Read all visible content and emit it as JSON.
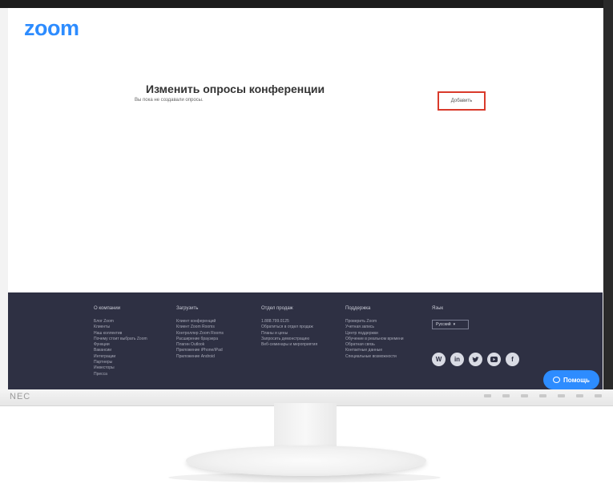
{
  "brand": {
    "logo_text": "zoom",
    "accent_color": "#2D8CFF"
  },
  "main": {
    "title": "Изменить опросы конференции",
    "empty_message": "Вы пока не создавали опросы.",
    "add_button_label": "Добавить"
  },
  "footer": {
    "columns": [
      {
        "title": "О компании",
        "links": [
          "Блог Zoom",
          "Клиенты",
          "Наш коллектив",
          "Почему стоит выбрать Zoom",
          "Функции",
          "Вакансии",
          "Интеграции",
          "Партнеры",
          "Инвесторы",
          "Пресса"
        ]
      },
      {
        "title": "Загрузить",
        "links": [
          "Клиент конференций",
          "Клиент Zoom Rooms",
          "Контроллер Zoom Rooms",
          "Расширение браузера",
          "Плагин Outlook",
          "Приложение iPhone/iPad",
          "Приложение Android"
        ]
      },
      {
        "title": "Отдел продаж",
        "links": [
          "1.888.799.0125",
          "Обратиться в отдел продаж",
          "Планы и цены",
          "Запросить демонстрацию",
          "Веб-семинары и мероприятия"
        ]
      },
      {
        "title": "Поддержка",
        "links": [
          "Проверить Zoom",
          "Учетная запись",
          "Центр поддержки",
          "Обучение в реальном времени",
          "Обратная связь",
          "Контактные данные",
          "Специальные возможности"
        ]
      }
    ],
    "language_title": "Язык",
    "language_selected": "Русский",
    "social": [
      "wordpress-icon",
      "linkedin-icon",
      "twitter-icon",
      "youtube-icon",
      "facebook-icon"
    ],
    "help_label": "Помощь",
    "background_color": "#2e3043"
  },
  "monitor": {
    "brand": "NEC"
  }
}
